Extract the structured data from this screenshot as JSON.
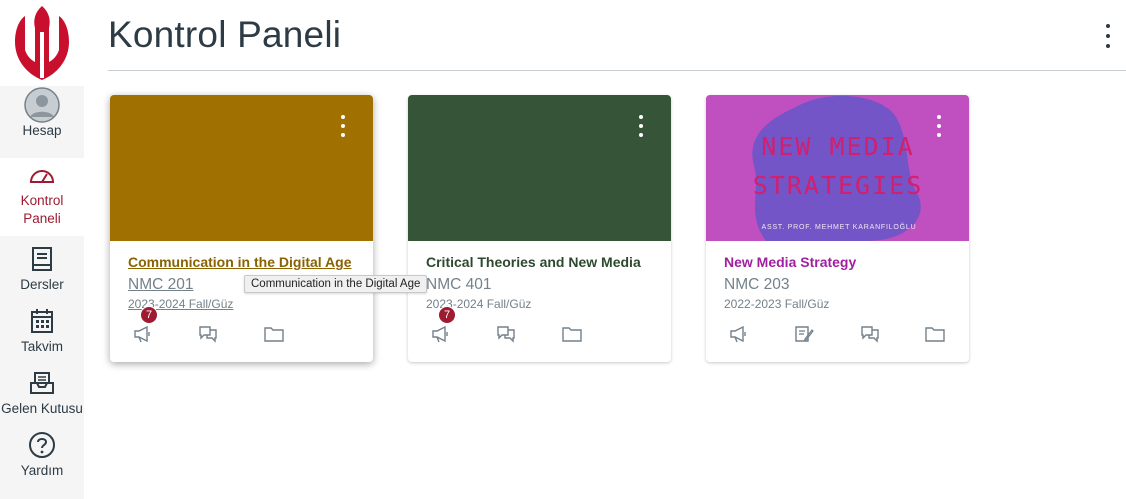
{
  "sidebar": {
    "items": [
      {
        "label": "Hesap"
      },
      {
        "label": "Kontrol Paneli"
      },
      {
        "label": "Dersler"
      },
      {
        "label": "Takvim"
      },
      {
        "label": "Gelen Kutusu"
      },
      {
        "label": "Yardım"
      }
    ]
  },
  "header": {
    "title": "Kontrol Paneli"
  },
  "cards": [
    {
      "title": "Communication in the Digital Age",
      "code": "NMC 201",
      "term": "2023-2024 Fall/Güz",
      "color": "#a07000",
      "title_color": "#8a6300",
      "badge": "7"
    },
    {
      "title": "Critical Theories and New Media",
      "code": "NMC 401",
      "term": "2023-2024 Fall/Güz",
      "color": "#365437",
      "title_color": "#2d4a2e",
      "badge": "7"
    },
    {
      "title": "New Media Strategy",
      "code": "NMC 203",
      "term": "2022-2023 Fall/Güz",
      "color": "#c04fc0",
      "title_color": "#a020a0",
      "image_text": {
        "line1": "NEW MEDIA",
        "line2": "STRATEGIES",
        "line3": "ASST. PROF. MEHMET KARANFILOĞLU"
      }
    }
  ],
  "tooltip": "Communication in the Digital Age"
}
